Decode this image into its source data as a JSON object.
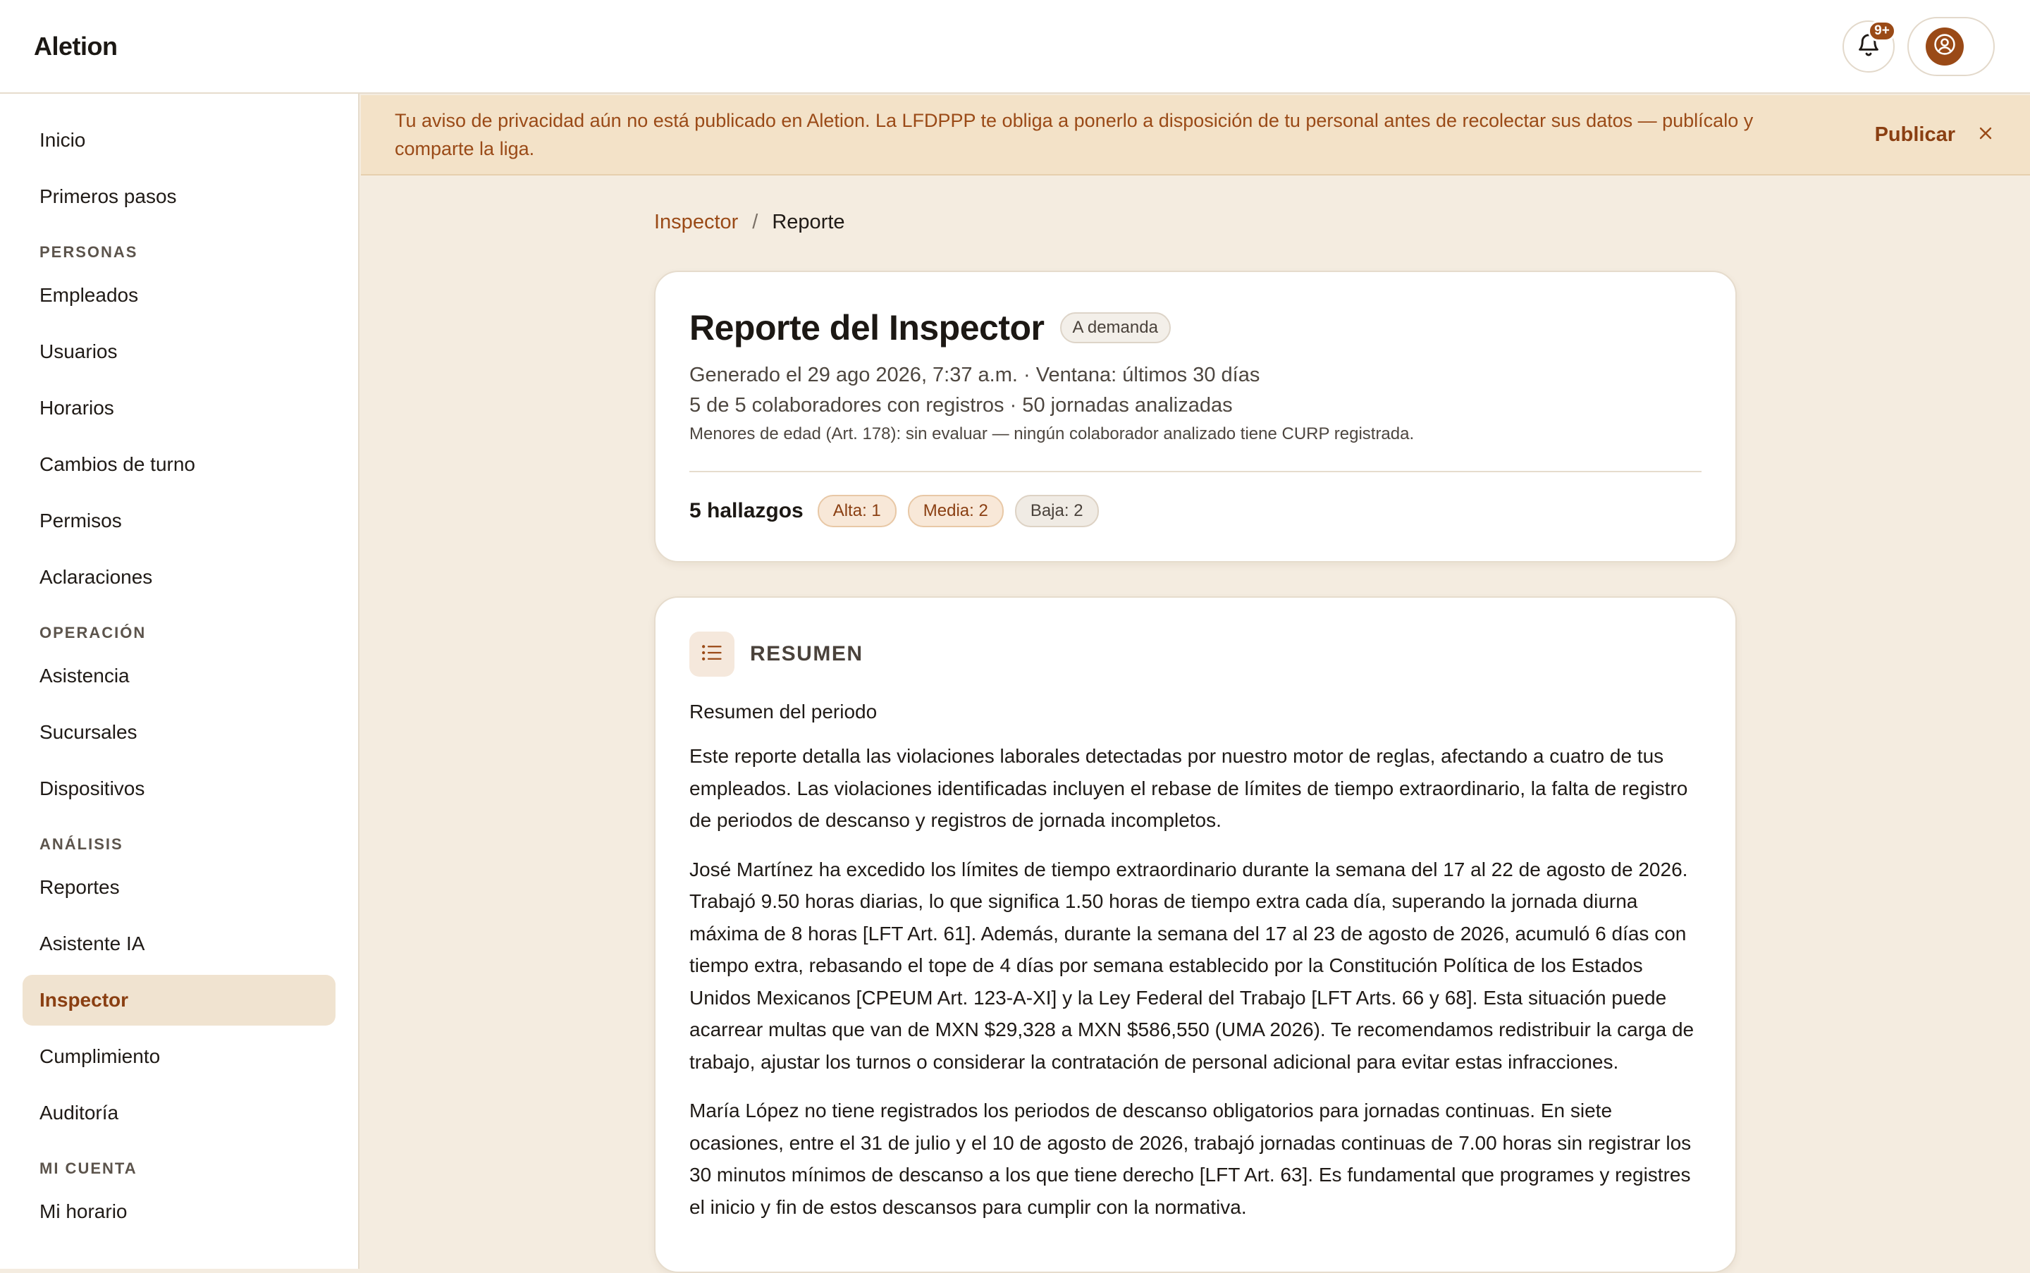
{
  "app": {
    "brand": "Aletion"
  },
  "topbar": {
    "notifications_badge": "9+"
  },
  "sidebar": {
    "items_top": [
      "Inicio",
      "Primeros pasos"
    ],
    "sections": [
      {
        "label": "PERSONAS",
        "items": [
          "Empleados",
          "Usuarios",
          "Horarios",
          "Cambios de turno",
          "Permisos",
          "Aclaraciones"
        ]
      },
      {
        "label": "OPERACIÓN",
        "items": [
          "Asistencia",
          "Sucursales",
          "Dispositivos"
        ]
      },
      {
        "label": "ANÁLISIS",
        "items": [
          "Reportes",
          "Asistente IA",
          "Inspector",
          "Cumplimiento",
          "Auditoría"
        ]
      },
      {
        "label": "MI CUENTA",
        "items": [
          "Mi horario"
        ]
      }
    ],
    "active_item": "Inspector"
  },
  "banner": {
    "text": "Tu aviso de privacidad aún no está publicado en Aletion. La LFDPPP te obliga a ponerlo a disposición de tu personal antes de recolectar sus datos — publícalo y comparte la liga.",
    "action_label": "Publicar"
  },
  "breadcrumb": {
    "parent": "Inspector",
    "separator": "/",
    "current": "Reporte"
  },
  "report": {
    "title": "Reporte del Inspector",
    "tag": "A demanda",
    "generated": "Generado el 29 ago 2026, 7:37 a.m. · Ventana: últimos 30 días",
    "scope": "5 de 5 colaboradores con registros · 50 jornadas analizadas",
    "minors_note": "Menores de edad (Art. 178): sin evaluar — ningún colaborador analizado tiene CURP registrada.",
    "findings_label": "5 hallazgos",
    "pills": {
      "alta": "Alta: 1",
      "media": "Media: 2",
      "baja": "Baja: 2"
    }
  },
  "summary": {
    "title": "RESUMEN",
    "subtitle": "Resumen del periodo",
    "paragraphs": [
      "Este reporte detalla las violaciones laborales detectadas por nuestro motor de reglas, afectando a cuatro de tus empleados. Las violaciones identificadas incluyen el rebase de límites de tiempo extraordinario, la falta de registro de periodos de descanso y registros de jornada incompletos.",
      "José Martínez ha excedido los límites de tiempo extraordinario durante la semana del 17 al 22 de agosto de 2026. Trabajó 9.50 horas diarias, lo que significa 1.50 horas de tiempo extra cada día, superando la jornada diurna máxima de 8 horas [LFT Art. 61]. Además, durante la semana del 17 al 23 de agosto de 2026, acumuló 6 días con tiempo extra, rebasando el tope de 4 días por semana establecido por la Constitución Política de los Estados Unidos Mexicanos [CPEUM Art. 123-A-XI] y la Ley Federal del Trabajo [LFT Arts. 66 y 68]. Esta situación puede acarrear multas que van de MXN $29,328 a MXN $586,550 (UMA 2026). Te recomendamos redistribuir la carga de trabajo, ajustar los turnos o considerar la contratación de personal adicional para evitar estas infracciones.",
      "María López no tiene registrados los periodos de descanso obligatorios para jornadas continuas. En siete ocasiones, entre el 31 de julio y el 10 de agosto de 2026, trabajó jornadas continuas de 7.00 horas sin registrar los 30 minutos mínimos de descanso a los que tiene derecho [LFT Art. 63]. Es fundamental que programes y registres el inicio y fin de estos descansos para cumplir con la normativa."
    ]
  }
}
